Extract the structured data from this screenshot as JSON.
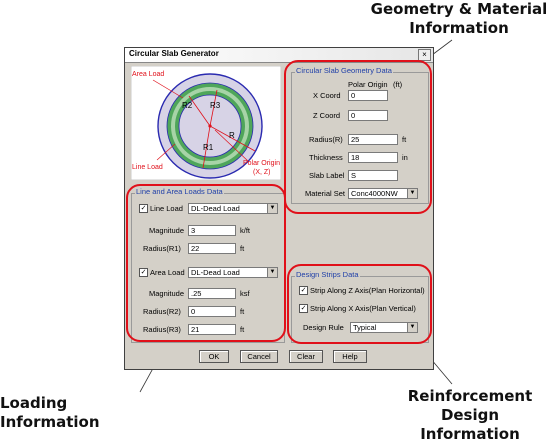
{
  "callouts": {
    "geometry": "Geometry & Material\nInformation",
    "loading": "Loading Information",
    "reinforcement": "Reinforcement\nDesign Information"
  },
  "dialog": {
    "title": "Circular Slab Generator",
    "close_glyph": "×"
  },
  "diagram": {
    "area_load": "Area Load",
    "line_load": "Line Load",
    "polar_origin": "Polar Origin",
    "polar_xz": "(X, Z)",
    "r1": "R1",
    "r2": "R2",
    "r3": "R3",
    "r": "R"
  },
  "geometry": {
    "group_title": "Circular Slab Geometry Data",
    "polar_origin_hdr": "Polar Origin",
    "polar_unit": "(ft)",
    "x_label": "X Coord",
    "x_value": "0",
    "z_label": "Z Coord",
    "z_value": "0",
    "radius_label": "Radius(R)",
    "radius_value": "25",
    "radius_unit": "ft",
    "thickness_label": "Thickness",
    "thickness_value": "18",
    "thickness_unit": "in",
    "slab_label_label": "Slab Label",
    "slab_label_value": "S",
    "material_label": "Material Set",
    "material_value": "Conc4000NW"
  },
  "loads": {
    "group_title": "Line and Area Loads Data",
    "line_load_label": "Line Load",
    "line_load_checked": "✓",
    "line_load_type": "DL-Dead Load",
    "magnitude_label": "Magnitude",
    "line_magnitude": "3",
    "line_magnitude_unit": "k/ft",
    "radius1_label": "Radius(R1)",
    "radius1_value": "22",
    "radius1_unit": "ft",
    "area_load_label": "Area Load",
    "area_load_checked": "✓",
    "area_load_type": "DL-Dead Load",
    "area_magnitude": ".25",
    "area_magnitude_unit": "ksf",
    "radius2_label": "Radius(R2)",
    "radius2_value": "0",
    "radius2_unit": "ft",
    "radius3_label": "Radius(R3)",
    "radius3_value": "21",
    "radius3_unit": "ft"
  },
  "strips": {
    "group_title": "Design Strips Data",
    "strip_z_label": "Strip Along Z Axis(Plan Horizontal)",
    "strip_z_checked": "✓",
    "strip_x_label": "Strip Along X Axis(Plan Vertical)",
    "strip_x_checked": "✓",
    "design_rule_label": "Design Rule",
    "design_rule_value": "Typical"
  },
  "buttons": {
    "ok": "OK",
    "cancel": "Cancel",
    "clear": "Clear",
    "help": "Help"
  },
  "colors": {
    "highlight": "#e0101a",
    "group_title": "#1f3fa8",
    "dialog_bg": "#d4d0c8"
  }
}
